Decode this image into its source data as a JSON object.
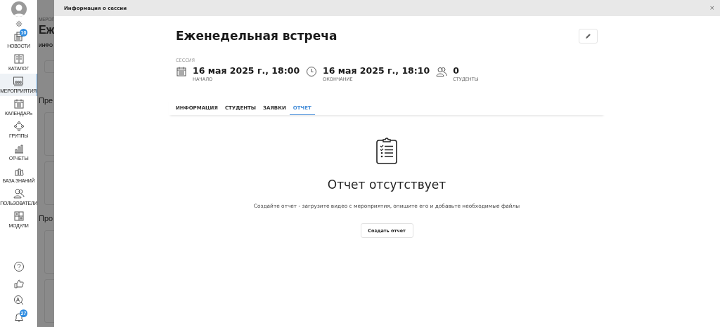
{
  "sidebar": {
    "items": [
      {
        "label": "НОВОСТИ",
        "badge": "10",
        "selected": false
      },
      {
        "label": "КАТАЛОГ",
        "selected": false
      },
      {
        "label": "МЕРОПРИЯТИЯ",
        "selected": true
      },
      {
        "label": "КАЛЕНДАРЬ",
        "selected": false
      },
      {
        "label": "ГРУППЫ",
        "selected": false
      },
      {
        "label": "ОТЧЕТЫ",
        "selected": false
      },
      {
        "label": "БАЗА ЗНАНИЙ",
        "selected": false
      },
      {
        "label": "ПОЛЬЗОВАТЕЛИ",
        "selected": false
      },
      {
        "label": "МОДУЛИ",
        "selected": false
      }
    ],
    "bottom": [
      {
        "kind": "help"
      },
      {
        "kind": "like"
      },
      {
        "kind": "translate"
      },
      {
        "kind": "bell",
        "badge": "27"
      }
    ]
  },
  "background_page": {
    "breadcrumb": "МЕРОП",
    "title": "Еж",
    "tab": "ИНФО",
    "section_1": "Пре",
    "section_2": "Про"
  },
  "modal": {
    "title": "Информация о сессии",
    "close": "×",
    "heading": "Еженедельная встреча",
    "session_label": "СЕССИЯ",
    "stats": [
      {
        "kind": "calendar",
        "value": "16 мая 2025 г., 18:00",
        "label": "НАЧАЛО"
      },
      {
        "kind": "clock",
        "value": "16 мая 2025 г., 18:10",
        "label": "ОКОНЧАНИЕ"
      },
      {
        "kind": "people",
        "value": "0",
        "label": "СТУДЕНТЫ"
      }
    ],
    "tabs": [
      {
        "label": "ИНФОРМАЦИЯ",
        "selected": false
      },
      {
        "label": "СТУДЕНТЫ",
        "selected": false
      },
      {
        "label": "ЗАЯВКИ",
        "selected": false
      },
      {
        "label": "ОТЧЕТ",
        "selected": true
      }
    ],
    "empty_state": {
      "title": "Отчет отсутствует",
      "description": "Создайте отчет - загрузите видео с мероприятия, опишите его и добавьте необходимые файлы",
      "button": "Создать отчет"
    }
  }
}
